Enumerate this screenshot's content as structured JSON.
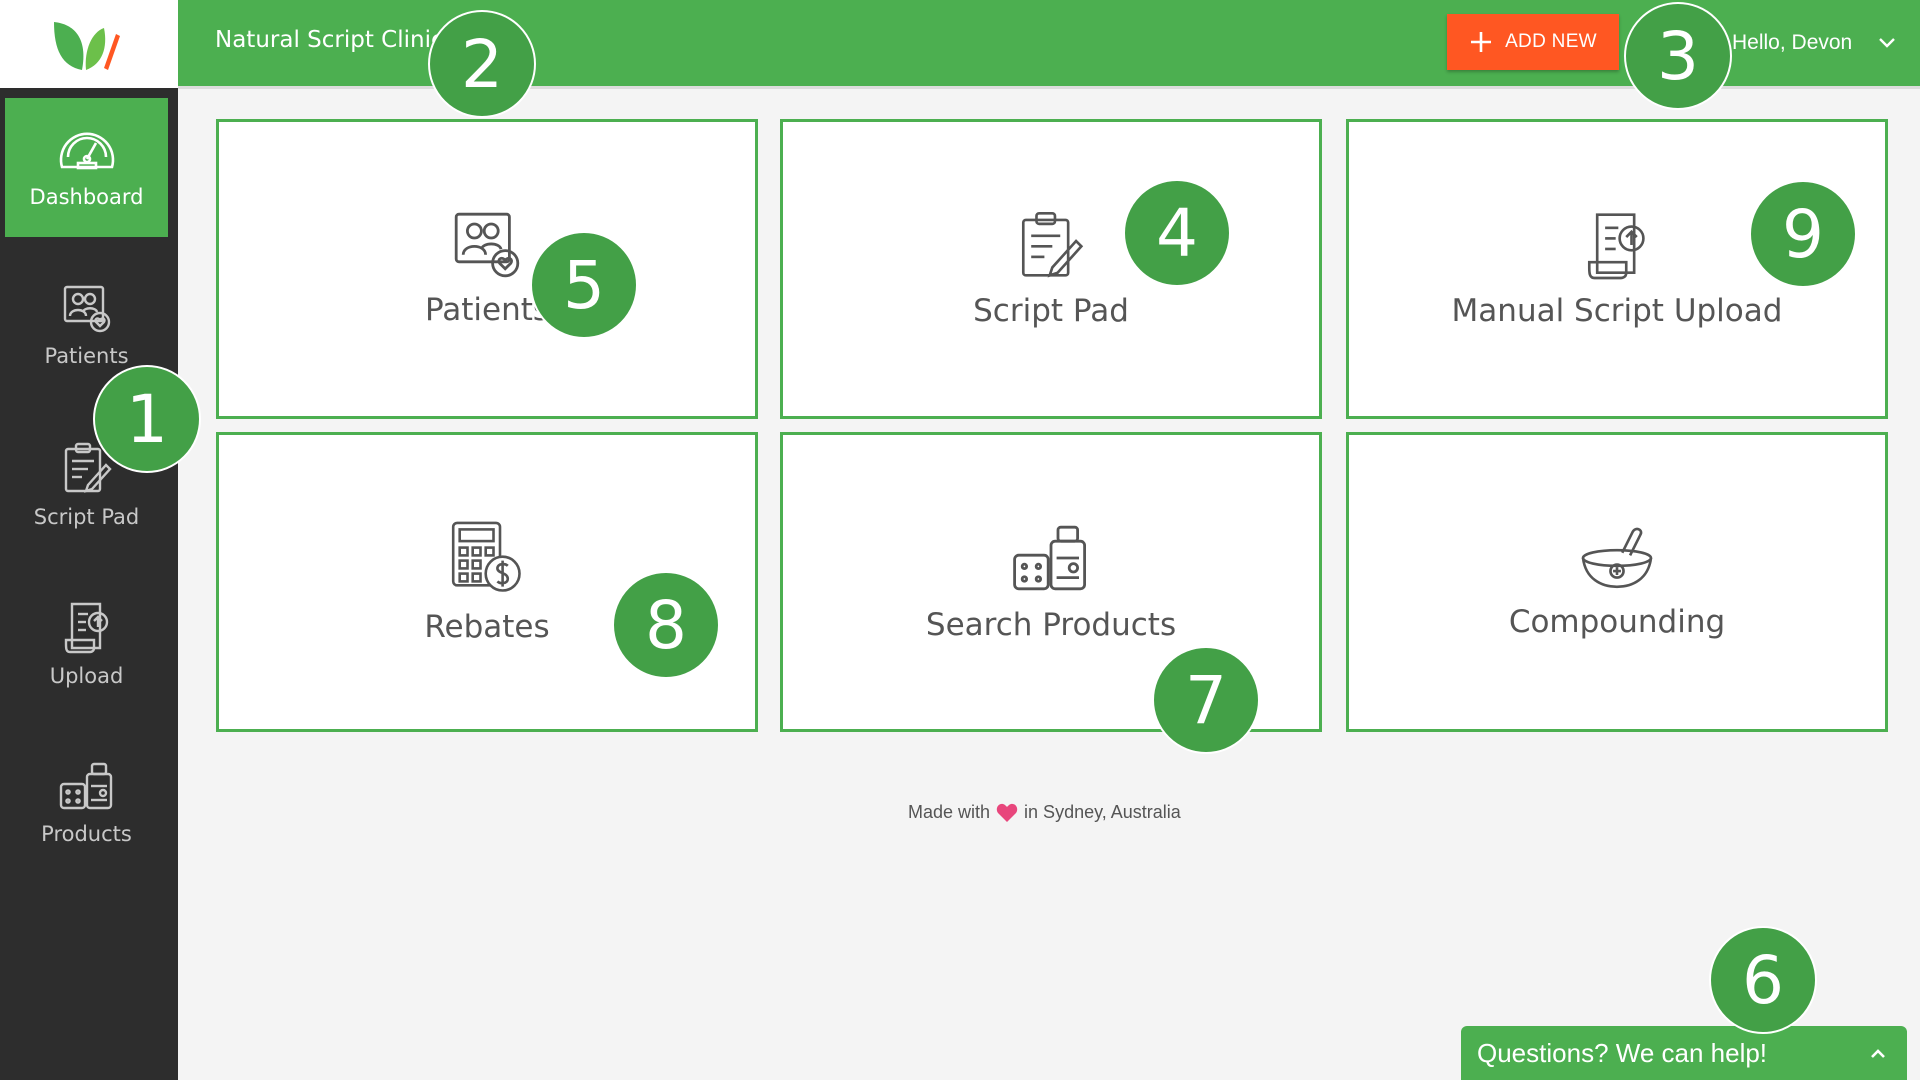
{
  "app": {
    "clinic_name": "Natural Script Clinic"
  },
  "topbar": {
    "add_new_label": "ADD NEW",
    "greeting": "Hello, Devon",
    "icons": {
      "add": "plus-icon",
      "user_menu": "chevron-down-icon"
    }
  },
  "sidebar": {
    "items": [
      {
        "label": "Dashboard",
        "icon": "speedometer-icon",
        "active": true
      },
      {
        "label": "Patients",
        "icon": "patients-icon",
        "active": false
      },
      {
        "label": "Script Pad",
        "icon": "script-pad-icon",
        "active": false
      },
      {
        "label": "Upload",
        "icon": "upload-icon",
        "active": false
      },
      {
        "label": "Products",
        "icon": "products-icon",
        "active": false
      }
    ]
  },
  "tiles": [
    {
      "label": "Patients",
      "icon": "patients-icon"
    },
    {
      "label": "Script Pad",
      "icon": "script-pad-icon"
    },
    {
      "label": "Manual Script Upload",
      "icon": "upload-icon"
    },
    {
      "label": "Rebates",
      "icon": "rebates-calculator-icon"
    },
    {
      "label": "Search Products",
      "icon": "products-icon"
    },
    {
      "label": "Compounding",
      "icon": "mortar-pestle-icon"
    }
  ],
  "footer": {
    "prefix": "Made with",
    "suffix": "in Sydney, Australia",
    "icon": "heart-icon"
  },
  "chat": {
    "label": "Questions? We can help!",
    "icon": "chevron-up-icon"
  },
  "callouts": [
    "1",
    "2",
    "3",
    "4",
    "5",
    "6",
    "7",
    "8",
    "9"
  ],
  "colors": {
    "brand_green": "#4caf50",
    "accent_orange": "#ff5722",
    "sidebar_dark": "#2d2d2d",
    "heart_pink": "#e8467c"
  }
}
